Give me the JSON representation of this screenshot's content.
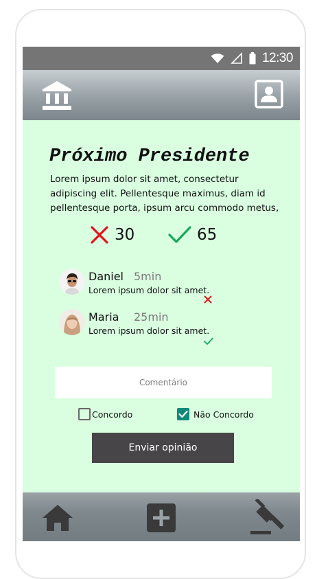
{
  "status_bar": {
    "time": "12:30",
    "icons": [
      "wifi-icon",
      "signal-icon",
      "battery-icon"
    ]
  },
  "app_bar": {
    "left_icon": "bank-icon",
    "right_icon": "profile-icon"
  },
  "main": {
    "title": "Próximo Presidente",
    "description": "Lorem ipsum dolor sit amet, consectetur adipiscing elit. Pellentesque maximus, diam id pellentesque porta, ipsum arcu commodo metus,",
    "votes": {
      "against": {
        "count": "30",
        "icon": "x-icon",
        "color": "#e0141e"
      },
      "for": {
        "count": "65",
        "icon": "check-icon",
        "color": "#17a85a"
      }
    },
    "comments": [
      {
        "name": "Daniel",
        "time": "5min",
        "text": "Lorem ipsum dolor sit amet.",
        "stance_icon": "x-icon"
      },
      {
        "name": "Maria",
        "time": "25min",
        "text": "Lorem ipsum dolor sit amet.",
        "stance_icon": "check-icon"
      }
    ],
    "comment_input": {
      "placeholder": "Comentário",
      "value": ""
    },
    "options": [
      {
        "label": "Concordo",
        "checked": false
      },
      {
        "label": "Não Concordo",
        "checked": true
      }
    ],
    "submit_label": "Enviar opinião"
  },
  "bottom_nav": {
    "items": [
      "home-icon",
      "add-icon",
      "gavel-icon"
    ]
  },
  "colors": {
    "content_bg": "#d9fee0",
    "accent": "#0f8a7a",
    "button_bg": "#474547"
  }
}
